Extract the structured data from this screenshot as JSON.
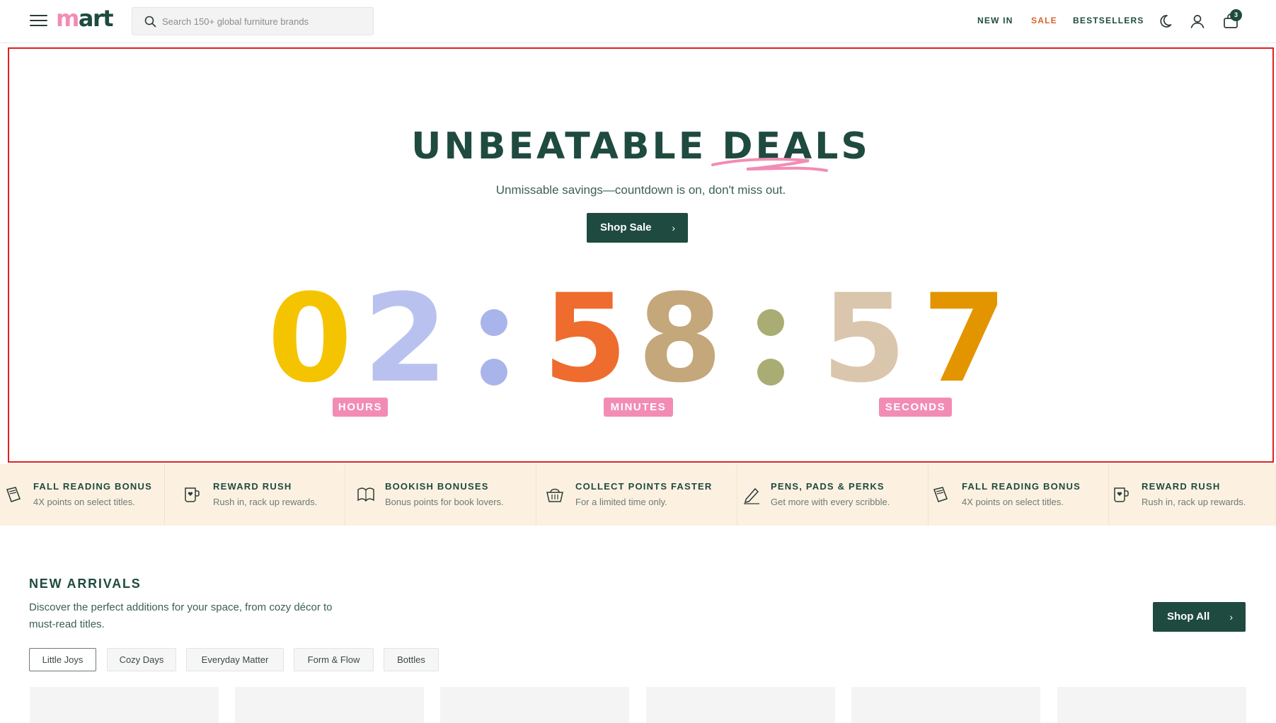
{
  "header": {
    "logo_m": "m",
    "logo_rest": "art",
    "search_placeholder": "Search 150+ global furniture brands",
    "nav": [
      "NEW IN",
      "SALE",
      "BESTSELLERS"
    ],
    "cart_count": "3",
    "icons": [
      "menu-icon",
      "search-icon",
      "moon-icon",
      "user-icon",
      "bag-icon"
    ]
  },
  "hero": {
    "title_part1": "UNBEATABLE ",
    "title_part2": "DEALS",
    "subtitle": "Unmissable savings—countdown is on, don't miss out.",
    "cta_label": "Shop Sale",
    "countdown": {
      "hours": [
        "0",
        "2"
      ],
      "minutes": [
        "5",
        "8"
      ],
      "seconds": [
        "5",
        "7"
      ],
      "labels": [
        "HOURS",
        "MINUTES",
        "SECONDS"
      ]
    }
  },
  "promos": [
    {
      "title": "FALL READING BONUS",
      "desc": "4X points on select titles.",
      "icon": "book-icon"
    },
    {
      "title": "REWARD RUSH",
      "desc": "Rush in, rack up rewards.",
      "icon": "mug-icon"
    },
    {
      "title": "BOOKISH BONUSES",
      "desc": "Bonus points for book lovers.",
      "icon": "open-book-icon"
    },
    {
      "title": "COLLECT POINTS FASTER",
      "desc": "For a limited time only.",
      "icon": "basket-icon"
    },
    {
      "title": "PENS, PADS & PERKS",
      "desc": "Get more with every scribble.",
      "icon": "pen-icon"
    },
    {
      "title": "FALL READING BONUS",
      "desc": "4X points on select titles.",
      "icon": "book-icon"
    },
    {
      "title": "REWARD RUSH",
      "desc": "Rush in, rack up rewards.",
      "icon": "mug-icon"
    }
  ],
  "new_arrivals": {
    "title": "NEW ARRIVALS",
    "desc": "Discover the perfect additions for your space, from cozy décor to must-read titles.",
    "cta_label": "Shop All",
    "filters": [
      "Little Joys",
      "Cozy Days",
      "Everyday Matter",
      "Form & Flow",
      "Bottles"
    ],
    "active_filter": "Little Joys"
  },
  "colors": {
    "brand_green": "#1f4a3f",
    "accent_pink": "#f28cb5",
    "sale_orange": "#d9622b",
    "promo_bg": "#fcf1e1"
  }
}
